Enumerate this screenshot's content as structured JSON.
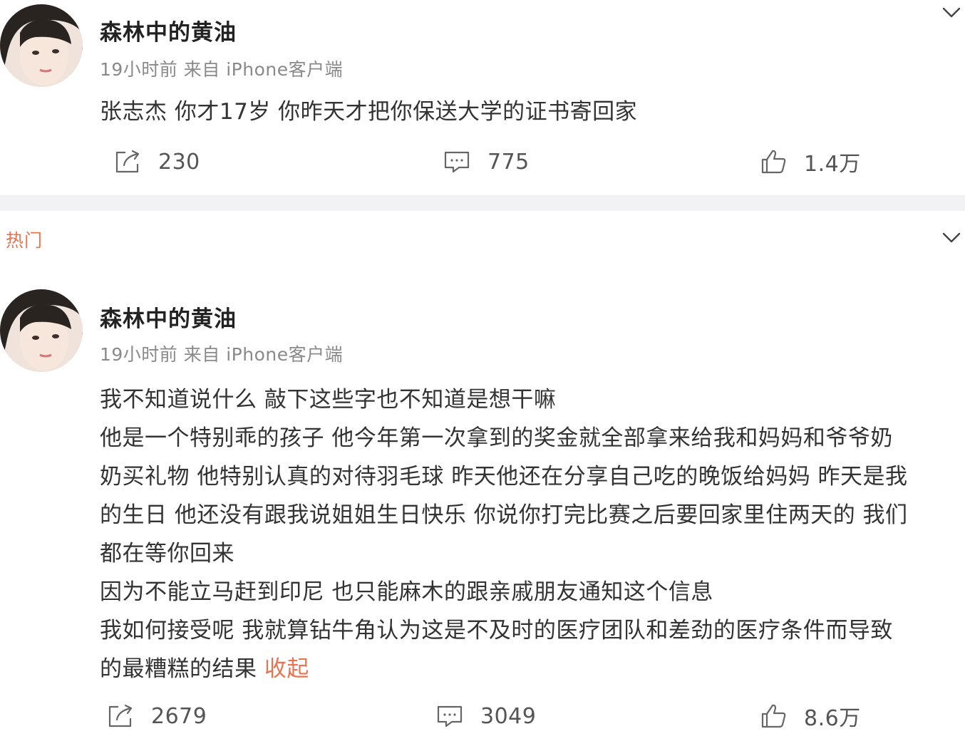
{
  "section_label": "热门",
  "posts": [
    {
      "username": "森林中的黄油",
      "meta": "19小时前 来自 iPhone客户端",
      "content_lines": [
        "张志杰 你才17岁 你昨天才把你保送大学的证书寄回家"
      ],
      "reposts": "230",
      "comments": "775",
      "likes": "1.4万"
    },
    {
      "username": "森林中的黄油",
      "meta": "19小时前 来自 iPhone客户端",
      "content_lines": [
        "我不知道说什么 敲下这些字也不知道是想干嘛",
        "他是一个特别乖的孩子 他今年第一次拿到的奖金就全部拿来给我和妈妈和爷爷奶",
        "奶买礼物 他特别认真的对待羽毛球 昨天他还在分享自己吃的晚饭给妈妈 昨天是我",
        "的生日 他还没有跟我说姐姐生日快乐 你说你打完比赛之后要回家里住两天的 我们",
        "都在等你回来",
        "因为不能立马赶到印尼 也只能麻木的跟亲戚朋友通知这个信息",
        "我如何接受呢 我就算钻牛角认为这是不及时的医疗团队和差劲的医疗条件而导致",
        "的最糟糕的结果 "
      ],
      "collapse_label": "收起",
      "reposts": "2679",
      "comments": "3049",
      "likes": "8.6万"
    }
  ],
  "colors": {
    "accent": "#eb7350",
    "text": "#333333",
    "meta": "#8a8a8a",
    "divider": "#f2f2f4"
  },
  "icons": {
    "avatar": "avatar",
    "repost": "repost-icon",
    "comment": "comment-icon",
    "like": "thumbs-up-icon",
    "more": "chevron-down-icon"
  }
}
